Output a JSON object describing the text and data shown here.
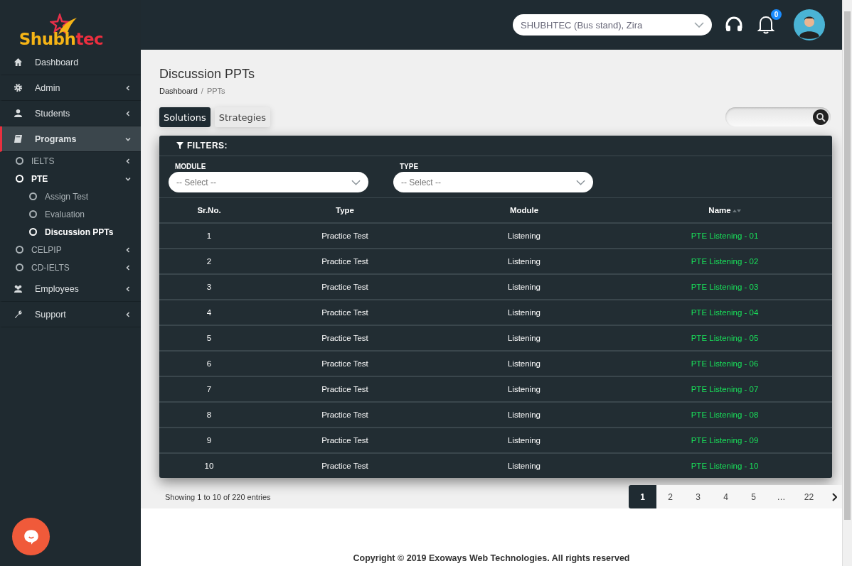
{
  "logo": {
    "text_main": "Shubh",
    "text_accent": "tec"
  },
  "sidebar": {
    "items": [
      {
        "label": "Dashboard",
        "kind": "link",
        "selected": false
      },
      {
        "label": "Admin",
        "kind": "menu",
        "selected": false,
        "expanded": false
      },
      {
        "label": "Students",
        "kind": "menu",
        "selected": false,
        "expanded": false
      },
      {
        "label": "Programs",
        "kind": "menu",
        "selected": true,
        "expanded": true,
        "children": [
          {
            "label": "IELTS",
            "kind": "menu",
            "selected": false,
            "expanded": false
          },
          {
            "label": "PTE",
            "kind": "menu",
            "selected": true,
            "expanded": true,
            "children": [
              {
                "label": "Assign Test",
                "selected": false
              },
              {
                "label": "Evaluation",
                "selected": false
              },
              {
                "label": "Discussion PPTs",
                "selected": true
              }
            ]
          },
          {
            "label": "CELPIP",
            "kind": "menu",
            "selected": false,
            "expanded": false
          },
          {
            "label": "CD-IELTS",
            "kind": "menu",
            "selected": false,
            "expanded": false
          }
        ]
      },
      {
        "label": "Employees",
        "kind": "menu",
        "selected": false,
        "expanded": false
      },
      {
        "label": "Support",
        "kind": "menu",
        "selected": false,
        "expanded": false
      }
    ]
  },
  "header": {
    "location_select": {
      "value": "SHUBHTEC (Bus stand), Zira"
    },
    "notifications_badge": "0"
  },
  "page": {
    "title": "Discussion PPTs",
    "breadcrumb": [
      "Dashboard",
      "PPTs"
    ],
    "breadcrumb_separator": "/"
  },
  "tabs": [
    {
      "label": "Solutions",
      "selected": true
    },
    {
      "label": "Strategies",
      "selected": false
    }
  ],
  "filters": {
    "title": "FILTERS:",
    "fields": [
      {
        "label": "MODULE",
        "placeholder": "-- Select --"
      },
      {
        "label": "TYPE",
        "placeholder": "-- Select --"
      }
    ]
  },
  "table": {
    "columns": [
      {
        "label": "Sr.No.",
        "sortable": false
      },
      {
        "label": "Type",
        "sortable": false
      },
      {
        "label": "Module",
        "sortable": false
      },
      {
        "label": "Name",
        "sortable": true
      }
    ],
    "rows": [
      [
        "1",
        "Practice Test",
        "Listening",
        "PTE Listening - 01"
      ],
      [
        "2",
        "Practice Test",
        "Listening",
        "PTE Listening - 02"
      ],
      [
        "3",
        "Practice Test",
        "Listening",
        "PTE Listening - 03"
      ],
      [
        "4",
        "Practice Test",
        "Listening",
        "PTE Listening - 04"
      ],
      [
        "5",
        "Practice Test",
        "Listening",
        "PTE Listening - 05"
      ],
      [
        "6",
        "Practice Test",
        "Listening",
        "PTE Listening - 06"
      ],
      [
        "7",
        "Practice Test",
        "Listening",
        "PTE Listening - 07"
      ],
      [
        "8",
        "Practice Test",
        "Listening",
        "PTE Listening - 08"
      ],
      [
        "9",
        "Practice Test",
        "Listening",
        "PTE Listening - 09"
      ],
      [
        "10",
        "Practice Test",
        "Listening",
        "PTE Listening - 10"
      ]
    ]
  },
  "table_info": "Showing 1 to 10 of 220 entries",
  "pagination": [
    {
      "label": "1",
      "selected": true
    },
    {
      "label": "2",
      "selected": false
    },
    {
      "label": "3",
      "selected": false
    },
    {
      "label": "4",
      "selected": false
    },
    {
      "label": "5",
      "selected": false
    },
    {
      "label": "…",
      "selected": false
    },
    {
      "label": "22",
      "selected": false
    }
  ],
  "footer": "Copyright © 2019 Exoways Web Technologies. All rights reserved"
}
